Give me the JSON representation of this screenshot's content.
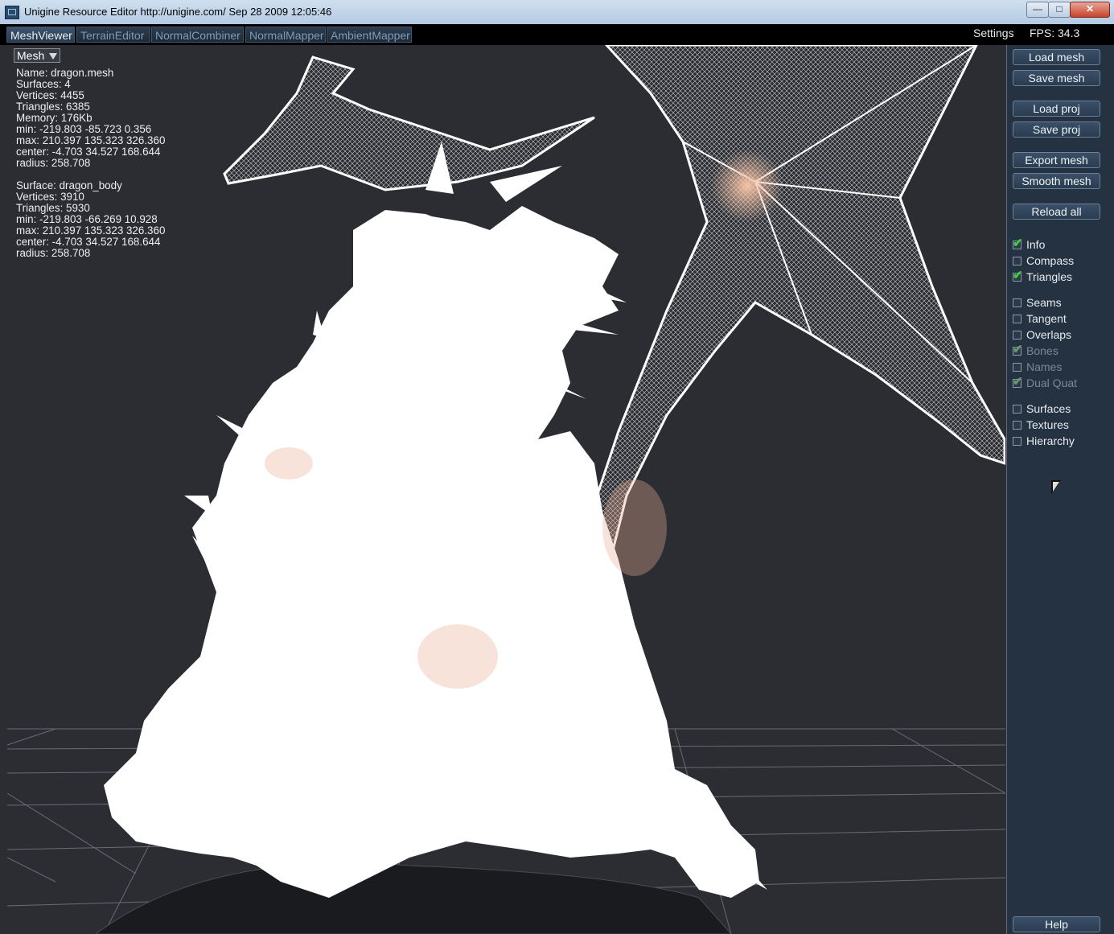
{
  "window": {
    "title": "Unigine Resource Editor http://unigine.com/ Sep 28 2009 12:05:46",
    "minimize_glyph": "—",
    "maximize_glyph": "□",
    "close_glyph": "✕"
  },
  "tabs": [
    {
      "label": "MeshViewer",
      "active": true
    },
    {
      "label": "TerrainEditor",
      "active": false
    },
    {
      "label": "NormalCombiner",
      "active": false
    },
    {
      "label": "NormalMapper",
      "active": false
    },
    {
      "label": "AmbientMapper",
      "active": false
    }
  ],
  "topbar": {
    "settings": "Settings",
    "fps": "FPS: 34.3"
  },
  "viewport": {
    "mode_select": "Mesh",
    "mesh_info": [
      "Name: dragon.mesh",
      "Surfaces: 4",
      "Vertices: 4455",
      "Triangles: 6385",
      "Memory: 176Kb",
      "min: -219.803 -85.723 0.356",
      "max: 210.397 135.323 326.360",
      "center: -4.703 34.527 168.644",
      "radius: 258.708"
    ],
    "surface_info": [
      "Surface: dragon_body",
      "Vertices: 3910",
      "Triangles: 5930",
      "min: -219.803 -66.269 10.928",
      "max: 210.397 135.323 326.360",
      "center: -4.703 34.527 168.644",
      "radius: 258.708"
    ]
  },
  "panel": {
    "buttons": {
      "load_mesh": "Load mesh",
      "save_mesh": "Save mesh",
      "load_proj": "Load proj",
      "save_proj": "Save proj",
      "export_mesh": "Export mesh",
      "smooth_mesh": "Smooth mesh",
      "reload_all": "Reload all",
      "help": "Help"
    },
    "checkboxes": [
      {
        "label": "Info",
        "checked": true,
        "enabled": true
      },
      {
        "label": "Compass",
        "checked": false,
        "enabled": true
      },
      {
        "label": "Triangles",
        "checked": true,
        "enabled": true
      },
      {
        "label": "Seams",
        "checked": false,
        "enabled": true
      },
      {
        "label": "Tangent",
        "checked": false,
        "enabled": true
      },
      {
        "label": "Overlaps",
        "checked": false,
        "enabled": true
      },
      {
        "label": "Bones",
        "checked": true,
        "enabled": false
      },
      {
        "label": "Names",
        "checked": false,
        "enabled": false
      },
      {
        "label": "Dual Quat",
        "checked": true,
        "enabled": false
      },
      {
        "label": "Surfaces",
        "checked": false,
        "enabled": true
      },
      {
        "label": "Textures",
        "checked": false,
        "enabled": true
      },
      {
        "label": "Hierarchy",
        "checked": false,
        "enabled": true
      }
    ]
  },
  "colors": {
    "viewport_bg": "#2b2d33",
    "panel_bg": "#253242",
    "check_tick": "#3fd13f"
  }
}
